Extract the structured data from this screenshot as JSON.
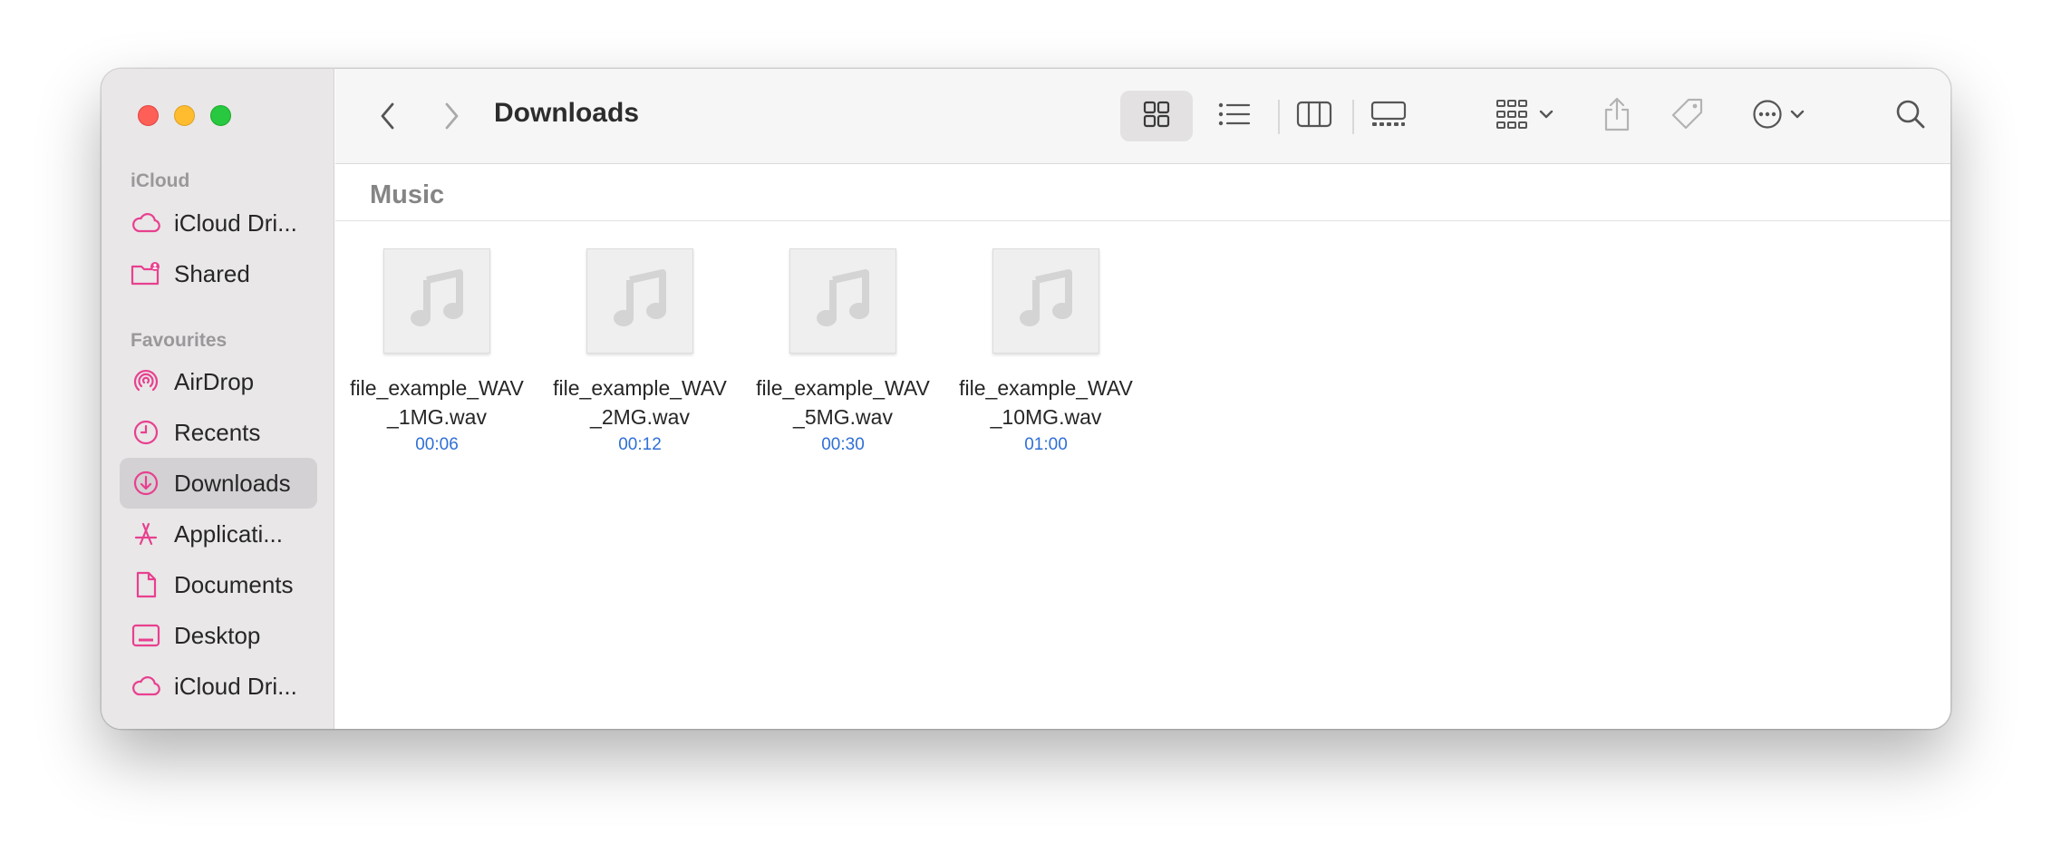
{
  "window": {
    "title": "Downloads"
  },
  "sidebar": {
    "sections": [
      {
        "title": "iCloud",
        "items": [
          {
            "label": "iCloud Dri...",
            "icon": "cloud-icon"
          },
          {
            "label": "Shared",
            "icon": "shared-folder-icon"
          }
        ]
      },
      {
        "title": "Favourites",
        "items": [
          {
            "label": "AirDrop",
            "icon": "airdrop-icon"
          },
          {
            "label": "Recents",
            "icon": "clock-icon"
          },
          {
            "label": "Downloads",
            "icon": "download-icon",
            "active": true
          },
          {
            "label": "Applicati...",
            "icon": "applications-icon"
          },
          {
            "label": "Documents",
            "icon": "document-icon"
          },
          {
            "label": "Desktop",
            "icon": "desktop-icon"
          },
          {
            "label": "iCloud Dri...",
            "icon": "cloud-icon"
          }
        ]
      }
    ],
    "accent_color": "#e8408f"
  },
  "toolbar": {
    "back": "chevron-left-icon",
    "forward": "chevron-right-icon",
    "views": [
      "icon-view-icon",
      "list-view-icon",
      "column-view-icon",
      "gallery-view-icon"
    ],
    "active_view": "icon-view-icon",
    "group": "group-by-icon",
    "share": "share-icon",
    "tag": "tag-icon",
    "more": "more-actions-icon",
    "search": "search-icon"
  },
  "content": {
    "group_title": "Music",
    "files": [
      {
        "name_line1": "file_example_WAV",
        "name_line2": "_1MG.wav",
        "duration": "00:06"
      },
      {
        "name_line1": "file_example_WAV",
        "name_line2": "_2MG.wav",
        "duration": "00:12"
      },
      {
        "name_line1": "file_example_WAV",
        "name_line2": "_5MG.wav",
        "duration": "00:30"
      },
      {
        "name_line1": "file_example_WAV",
        "name_line2": "_10MG.wav",
        "duration": "01:00"
      }
    ],
    "duration_color": "#2f6fd6"
  }
}
